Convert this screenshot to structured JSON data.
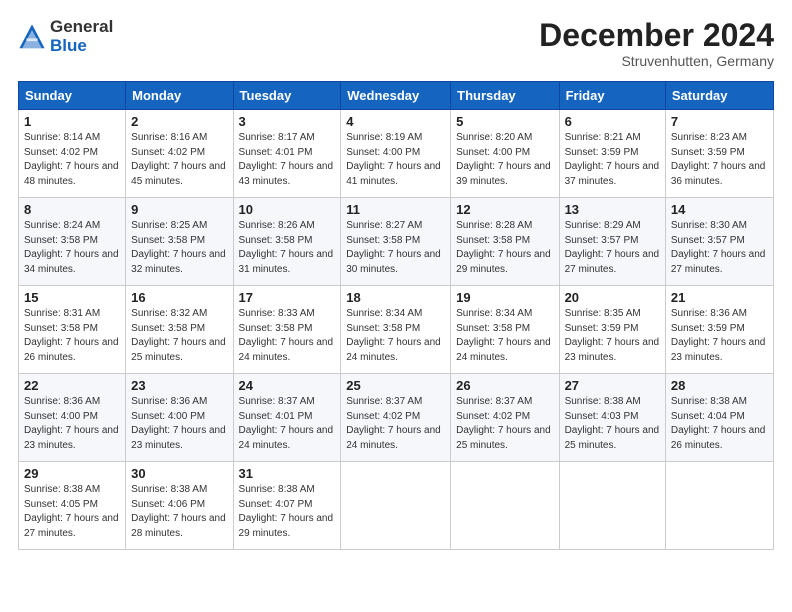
{
  "header": {
    "logo_general": "General",
    "logo_blue": "Blue",
    "month_title": "December 2024",
    "location": "Struvenhutten, Germany"
  },
  "days_of_week": [
    "Sunday",
    "Monday",
    "Tuesday",
    "Wednesday",
    "Thursday",
    "Friday",
    "Saturday"
  ],
  "weeks": [
    [
      {
        "day": "1",
        "sunrise": "Sunrise: 8:14 AM",
        "sunset": "Sunset: 4:02 PM",
        "daylight": "Daylight: 7 hours and 48 minutes."
      },
      {
        "day": "2",
        "sunrise": "Sunrise: 8:16 AM",
        "sunset": "Sunset: 4:02 PM",
        "daylight": "Daylight: 7 hours and 45 minutes."
      },
      {
        "day": "3",
        "sunrise": "Sunrise: 8:17 AM",
        "sunset": "Sunset: 4:01 PM",
        "daylight": "Daylight: 7 hours and 43 minutes."
      },
      {
        "day": "4",
        "sunrise": "Sunrise: 8:19 AM",
        "sunset": "Sunset: 4:00 PM",
        "daylight": "Daylight: 7 hours and 41 minutes."
      },
      {
        "day": "5",
        "sunrise": "Sunrise: 8:20 AM",
        "sunset": "Sunset: 4:00 PM",
        "daylight": "Daylight: 7 hours and 39 minutes."
      },
      {
        "day": "6",
        "sunrise": "Sunrise: 8:21 AM",
        "sunset": "Sunset: 3:59 PM",
        "daylight": "Daylight: 7 hours and 37 minutes."
      },
      {
        "day": "7",
        "sunrise": "Sunrise: 8:23 AM",
        "sunset": "Sunset: 3:59 PM",
        "daylight": "Daylight: 7 hours and 36 minutes."
      }
    ],
    [
      {
        "day": "8",
        "sunrise": "Sunrise: 8:24 AM",
        "sunset": "Sunset: 3:58 PM",
        "daylight": "Daylight: 7 hours and 34 minutes."
      },
      {
        "day": "9",
        "sunrise": "Sunrise: 8:25 AM",
        "sunset": "Sunset: 3:58 PM",
        "daylight": "Daylight: 7 hours and 32 minutes."
      },
      {
        "day": "10",
        "sunrise": "Sunrise: 8:26 AM",
        "sunset": "Sunset: 3:58 PM",
        "daylight": "Daylight: 7 hours and 31 minutes."
      },
      {
        "day": "11",
        "sunrise": "Sunrise: 8:27 AM",
        "sunset": "Sunset: 3:58 PM",
        "daylight": "Daylight: 7 hours and 30 minutes."
      },
      {
        "day": "12",
        "sunrise": "Sunrise: 8:28 AM",
        "sunset": "Sunset: 3:58 PM",
        "daylight": "Daylight: 7 hours and 29 minutes."
      },
      {
        "day": "13",
        "sunrise": "Sunrise: 8:29 AM",
        "sunset": "Sunset: 3:57 PM",
        "daylight": "Daylight: 7 hours and 27 minutes."
      },
      {
        "day": "14",
        "sunrise": "Sunrise: 8:30 AM",
        "sunset": "Sunset: 3:57 PM",
        "daylight": "Daylight: 7 hours and 27 minutes."
      }
    ],
    [
      {
        "day": "15",
        "sunrise": "Sunrise: 8:31 AM",
        "sunset": "Sunset: 3:58 PM",
        "daylight": "Daylight: 7 hours and 26 minutes."
      },
      {
        "day": "16",
        "sunrise": "Sunrise: 8:32 AM",
        "sunset": "Sunset: 3:58 PM",
        "daylight": "Daylight: 7 hours and 25 minutes."
      },
      {
        "day": "17",
        "sunrise": "Sunrise: 8:33 AM",
        "sunset": "Sunset: 3:58 PM",
        "daylight": "Daylight: 7 hours and 24 minutes."
      },
      {
        "day": "18",
        "sunrise": "Sunrise: 8:34 AM",
        "sunset": "Sunset: 3:58 PM",
        "daylight": "Daylight: 7 hours and 24 minutes."
      },
      {
        "day": "19",
        "sunrise": "Sunrise: 8:34 AM",
        "sunset": "Sunset: 3:58 PM",
        "daylight": "Daylight: 7 hours and 24 minutes."
      },
      {
        "day": "20",
        "sunrise": "Sunrise: 8:35 AM",
        "sunset": "Sunset: 3:59 PM",
        "daylight": "Daylight: 7 hours and 23 minutes."
      },
      {
        "day": "21",
        "sunrise": "Sunrise: 8:36 AM",
        "sunset": "Sunset: 3:59 PM",
        "daylight": "Daylight: 7 hours and 23 minutes."
      }
    ],
    [
      {
        "day": "22",
        "sunrise": "Sunrise: 8:36 AM",
        "sunset": "Sunset: 4:00 PM",
        "daylight": "Daylight: 7 hours and 23 minutes."
      },
      {
        "day": "23",
        "sunrise": "Sunrise: 8:36 AM",
        "sunset": "Sunset: 4:00 PM",
        "daylight": "Daylight: 7 hours and 23 minutes."
      },
      {
        "day": "24",
        "sunrise": "Sunrise: 8:37 AM",
        "sunset": "Sunset: 4:01 PM",
        "daylight": "Daylight: 7 hours and 24 minutes."
      },
      {
        "day": "25",
        "sunrise": "Sunrise: 8:37 AM",
        "sunset": "Sunset: 4:02 PM",
        "daylight": "Daylight: 7 hours and 24 minutes."
      },
      {
        "day": "26",
        "sunrise": "Sunrise: 8:37 AM",
        "sunset": "Sunset: 4:02 PM",
        "daylight": "Daylight: 7 hours and 25 minutes."
      },
      {
        "day": "27",
        "sunrise": "Sunrise: 8:38 AM",
        "sunset": "Sunset: 4:03 PM",
        "daylight": "Daylight: 7 hours and 25 minutes."
      },
      {
        "day": "28",
        "sunrise": "Sunrise: 8:38 AM",
        "sunset": "Sunset: 4:04 PM",
        "daylight": "Daylight: 7 hours and 26 minutes."
      }
    ],
    [
      {
        "day": "29",
        "sunrise": "Sunrise: 8:38 AM",
        "sunset": "Sunset: 4:05 PM",
        "daylight": "Daylight: 7 hours and 27 minutes."
      },
      {
        "day": "30",
        "sunrise": "Sunrise: 8:38 AM",
        "sunset": "Sunset: 4:06 PM",
        "daylight": "Daylight: 7 hours and 28 minutes."
      },
      {
        "day": "31",
        "sunrise": "Sunrise: 8:38 AM",
        "sunset": "Sunset: 4:07 PM",
        "daylight": "Daylight: 7 hours and 29 minutes."
      },
      null,
      null,
      null,
      null
    ]
  ]
}
